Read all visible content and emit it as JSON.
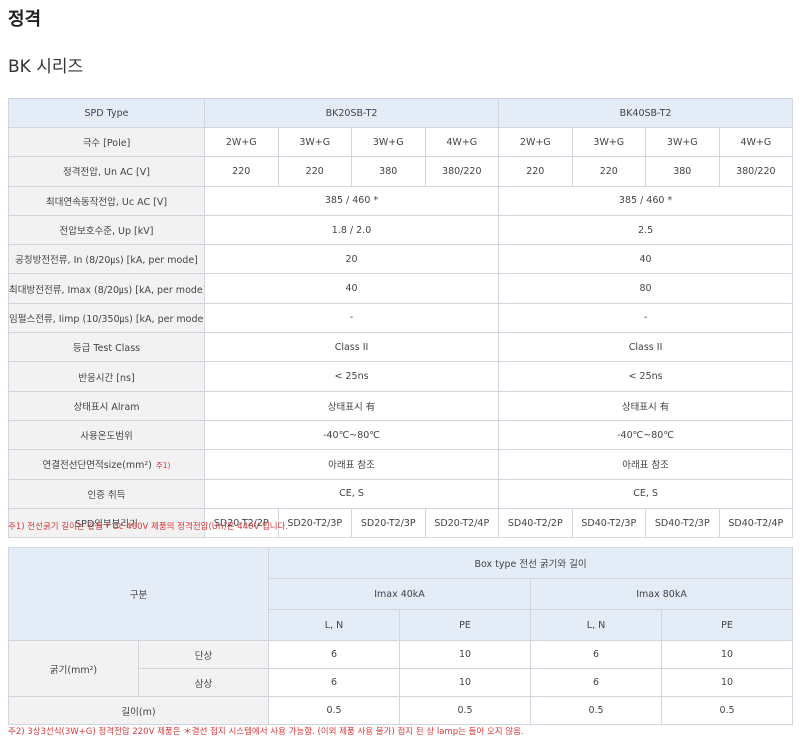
{
  "page": {
    "title": "정격",
    "series": "BK 시리즈"
  },
  "spec": {
    "type_label": "SPD Type",
    "models": [
      "BK20SB-T2",
      "BK40SB-T2"
    ],
    "pole": {
      "label": "극수 [Pole]",
      "values": [
        "2W+G",
        "3W+G",
        "3W+G",
        "4W+G",
        "2W+G",
        "3W+G",
        "3W+G",
        "4W+G"
      ]
    },
    "rated_voltage": {
      "label": "정격전압, Un AC [V]",
      "values": [
        "220",
        "220",
        "380",
        "380/220",
        "220",
        "220",
        "380",
        "380/220"
      ]
    },
    "max_continuous_voltage": {
      "label": "최대연속동작전압, Uc AC [V]",
      "values": [
        "385 / 460 *",
        "385 / 460 *"
      ]
    },
    "protection_level": {
      "label": "전압보호수준, Up [kV]",
      "values": [
        "1.8 / 2.0",
        "2.5"
      ]
    },
    "nominal_current": {
      "label": "공칭방전전류, In (8/20㎲) [kA, per mode]",
      "values": [
        "20",
        "40"
      ]
    },
    "max_current": {
      "label": "최대방전전류, Imax (8/20㎲) [kA, per mode]",
      "values": [
        "40",
        "80"
      ]
    },
    "impulse_current": {
      "label": "임펄스전류, Iimp (10/350㎲) [kA, per mode]",
      "values": [
        "-",
        "-"
      ]
    },
    "test_class": {
      "label": "등급 Test Class",
      "values": [
        "Class II",
        "Class II"
      ]
    },
    "response_time": {
      "label": "반응시간 [ns]",
      "values": [
        "< 25ns",
        "< 25ns"
      ]
    },
    "alarm": {
      "label": "상태표시 Alram",
      "values": [
        "상태표시 有",
        "상태표시 有"
      ]
    },
    "temperature": {
      "label": "사용온도범위",
      "values": [
        "-40℃~80℃",
        "-40℃~80℃"
      ]
    },
    "wire_size": {
      "label": "연결전선단면적size(mm²)",
      "footnote": "주1)",
      "values": [
        "아래표 참조",
        "아래표 참조"
      ]
    },
    "certification": {
      "label": "인증 취득",
      "values": [
        "CE, S",
        "CE, S"
      ]
    },
    "separator": {
      "label": "SPD외부분리기",
      "values": [
        "SD20-T2/2P",
        "SD20-T2/3P",
        "SD20-T2/3P",
        "SD20-T2/4P",
        "SD40-T2/2P",
        "SD40-T2/3P",
        "SD40-T2/3P",
        "SD40-T2/4P"
      ]
    }
  },
  "note1": "주1) 전선굵기 길이는 같음 * Uc 460V 제품의 정격전압(Un)은 440V 입니다.",
  "wire": {
    "category_label": "구분",
    "box_header": "Box type 전선 굵기와 길이",
    "groups": [
      "Imax 40kA",
      "Imax 80kA"
    ],
    "sub_headers": [
      "L, N",
      "PE",
      "L, N",
      "PE"
    ],
    "thickness_label": "굵기(mm²)",
    "rows": [
      {
        "label": "단상",
        "values": [
          "6",
          "10",
          "6",
          "10"
        ]
      },
      {
        "label": "삼상",
        "values": [
          "6",
          "10",
          "6",
          "10"
        ]
      }
    ],
    "length": {
      "label": "길이(m)",
      "values": [
        "0.5",
        "0.5",
        "0.5",
        "0.5"
      ]
    }
  },
  "note2": "주2) 3상3선식(3W+G) 정격전압 220V 제품은 ＊결선 접지 시스템에서 사용 가능함. (이외 제품 사용 불가) 접지 된 상 lamp는 들어 오지 않음."
}
